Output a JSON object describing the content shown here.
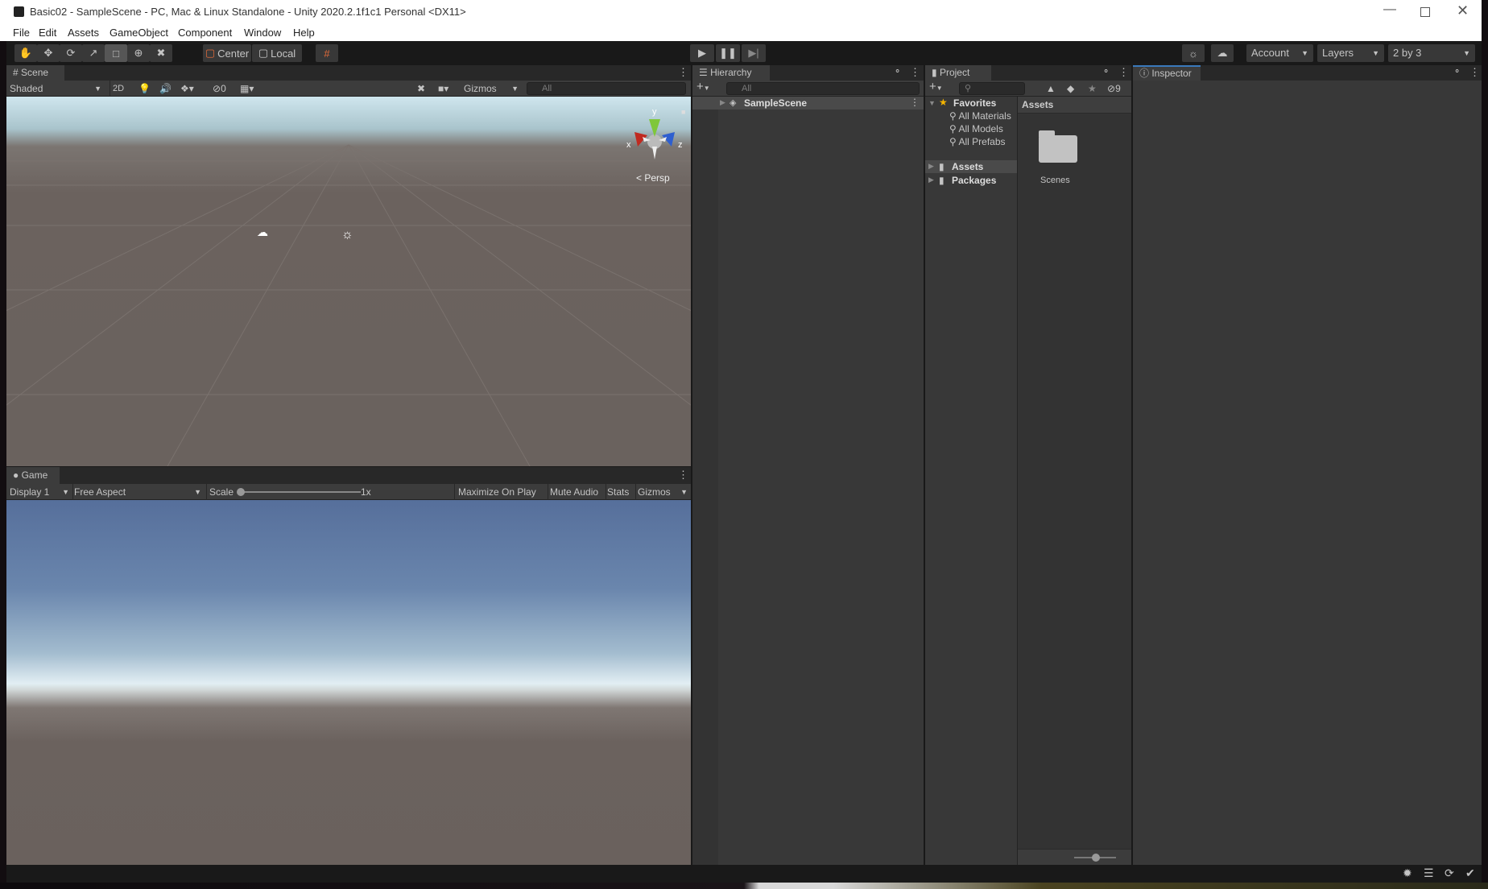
{
  "window": {
    "title": "Basic02 - SampleScene - PC, Mac & Linux Standalone - Unity 2020.2.1f1c1 Personal <DX11>"
  },
  "menu": [
    "File",
    "Edit",
    "Assets",
    "GameObject",
    "Component",
    "Window",
    "Help"
  ],
  "toolbar": {
    "pivot": "Center",
    "space": "Local",
    "account": "Account",
    "layers": "Layers",
    "layout": "2 by 3"
  },
  "scene": {
    "tab": "Scene",
    "shading": "Shaded",
    "mode_2d": "2D",
    "hidden_count": "0",
    "gizmos": "Gizmos",
    "search_placeholder": "All",
    "camera_mode": "Persp",
    "axis_x": "x",
    "axis_y": "y",
    "axis_z": "z"
  },
  "game": {
    "tab": "Game",
    "display": "Display 1",
    "aspect": "Free Aspect",
    "scale_label": "Scale",
    "scale_value": "1x",
    "maximize": "Maximize On Play",
    "mute": "Mute Audio",
    "stats": "Stats",
    "gizmos": "Gizmos"
  },
  "hierarchy": {
    "tab": "Hierarchy",
    "search_placeholder": "All",
    "items": [
      {
        "label": "SampleScene"
      }
    ]
  },
  "project": {
    "tab": "Project",
    "hidden_count": "9",
    "favorites": "Favorites",
    "fav_items": [
      "All Materials",
      "All Models",
      "All Prefabs"
    ],
    "roots": [
      "Assets",
      "Packages"
    ],
    "breadcrumb": "Assets",
    "assets": [
      {
        "label": "Scenes",
        "icon": "folder-icon"
      }
    ]
  },
  "inspector": {
    "tab": "Inspector"
  },
  "colors": {
    "accent": "#3a79bb",
    "panel": "#383838",
    "toolbar": "#191919"
  }
}
